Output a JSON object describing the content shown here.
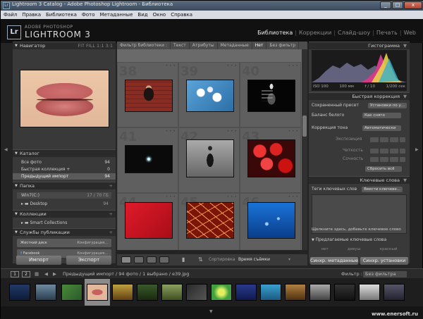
{
  "window": {
    "title": "Lightroom 3 Catalog - Adobe Photoshop Lightroom - Библиотека",
    "app_icon": "Lr",
    "controls": [
      "_",
      "□",
      "x"
    ]
  },
  "menu": [
    "Файл",
    "Правка",
    "Библиотека",
    "Фото",
    "Метаданные",
    "Вид",
    "Окно",
    "Справка"
  ],
  "identity": {
    "logo": "Lr",
    "brand_top": "ADOBE PHOTOSHOP",
    "brand_main": "LIGHTROOM 3"
  },
  "modules": {
    "library": "Библиотека",
    "develop": "Коррекции",
    "slideshow": "Слайд-шоу",
    "print": "Печать",
    "web": "Web"
  },
  "navigator": {
    "title": "Навигатор",
    "zoom": "FIT  FILL  1:1  3:1"
  },
  "catalog": {
    "title": "Каталог",
    "items": [
      {
        "label": "Все фото",
        "count": "94"
      },
      {
        "label": "Быстрая коллекция +",
        "count": "0"
      },
      {
        "label": "Предыдущий импорт",
        "count": "94"
      }
    ]
  },
  "folders": {
    "title": "Папка",
    "drive": "Win7(C:)",
    "drive_info": "17 / 70 ГБ",
    "folder": "Desktop",
    "folder_count": "94"
  },
  "collections": {
    "title": "Коллекции",
    "item": "Smart Collections"
  },
  "publish": {
    "title": "Службы публикации",
    "items": [
      {
        "label": "Жесткий диск",
        "action": "Конфигурация..."
      },
      {
        "label": "Facebook",
        "action": "Конфигурация..."
      }
    ]
  },
  "left_buttons": {
    "import": "Импорт",
    "export": "Экспорт"
  },
  "filterbar": {
    "title": "Фильтр библиотеки :",
    "items": [
      "Текст",
      "Атрибуты",
      "Метаданные",
      "Нет"
    ],
    "active": "Нет",
    "preset": "Без фильтр"
  },
  "grid": {
    "cells": [
      {
        "num": "38",
        "kind": "girl"
      },
      {
        "num": "39",
        "kind": "blossom"
      },
      {
        "num": "40",
        "kind": "xray"
      },
      {
        "num": "41",
        "kind": "dark"
      },
      {
        "num": "42",
        "kind": "bw"
      },
      {
        "num": "43",
        "kind": "berries"
      },
      {
        "num": "44",
        "kind": "red"
      },
      {
        "num": "45",
        "kind": "cracked"
      },
      {
        "num": "46",
        "kind": "water"
      }
    ]
  },
  "toolbar": {
    "sort_label": "Сортировка",
    "sort_value": "Время съёмки"
  },
  "histogram": {
    "title": "Гистограмма",
    "iso": "ISO 100",
    "focal": "100 мм",
    "aperture": "f / 10",
    "shutter": "1/200 сек"
  },
  "quick_develop": {
    "title": "Быстрая коррекция",
    "saved_preset_label": "Сохраненный пресет",
    "saved_preset_value": "Установки по у...",
    "wb_label": "Баланс белого",
    "wb_value": "Как снято",
    "tone_label": "Коррекция тона",
    "tone_button": "Автоматически",
    "rows": [
      "Экспозиция",
      "Четкость",
      "Сочность"
    ],
    "reset": "Сбросить всё"
  },
  "keywords": {
    "title": "Ключевые слова",
    "tags_label": "Теги ключевых слов",
    "tags_value": "Ввести ключеве...",
    "hint": "Щелкните здесь, добавьте ключевое слово",
    "suggested": "Предлагаемые ключевые слова",
    "sets": [
      "нет",
      "девуш",
      "красный"
    ]
  },
  "right_buttons": {
    "sync_meta": "Синхр. метаданные",
    "sync_settings": "Синхр. установки"
  },
  "filmstrip_bar": {
    "page1": "1",
    "page2": "2",
    "source": "Предыдущий импорт / 94 фото / 1 выбрано / e39.jpg",
    "filter_label": "Фильтр :",
    "filter_value": "Без фильтра"
  },
  "watermark": "www.enersoft.ru"
}
